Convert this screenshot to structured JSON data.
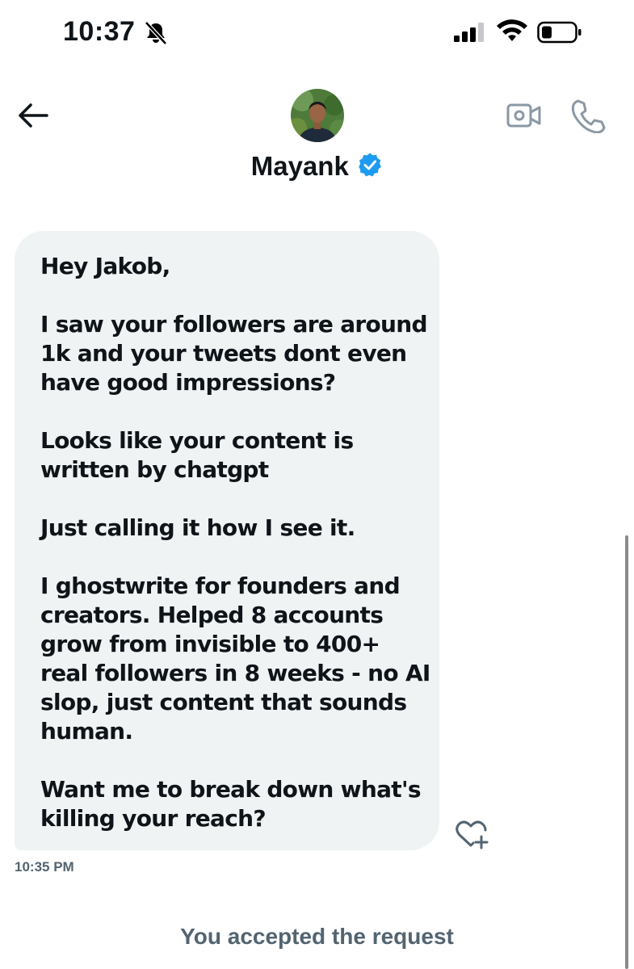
{
  "status_bar": {
    "time": "10:37",
    "icons": [
      "bell-slash-icon",
      "cellular-signal-icon",
      "wifi-icon",
      "battery-icon"
    ]
  },
  "header": {
    "contact_name": "Mayank",
    "icons": [
      "back-arrow-icon",
      "avatar",
      "verified-badge-icon",
      "video-call-icon",
      "phone-icon"
    ]
  },
  "conversation": {
    "message": {
      "paragraphs": [
        [
          "Hey Jakob,"
        ],
        [
          "I saw your followers are around",
          "1k and your tweets dont even",
          "have good impressions?"
        ],
        [
          "Looks like your content is",
          "written by chatgpt"
        ],
        [
          "Just calling it how I see it."
        ],
        [
          "I ghostwrite for founders and",
          "creators. Helped 8 accounts",
          "grow from invisible to 400+",
          "real followers in 8 weeks - no AI",
          "slop, just content that sounds",
          "human."
        ],
        [
          "Want me to break down what's",
          "killing your reach?"
        ]
      ],
      "timestamp": "10:35 PM",
      "reaction_icon": "heart-plus-icon"
    },
    "system_message": "You accepted the request"
  },
  "colors": {
    "bubble_bg": "#eff3f4",
    "text_primary": "#0f1419",
    "text_secondary": "#536471",
    "verified_blue": "#1d9bf0",
    "icon_gray": "#8b98a5"
  }
}
